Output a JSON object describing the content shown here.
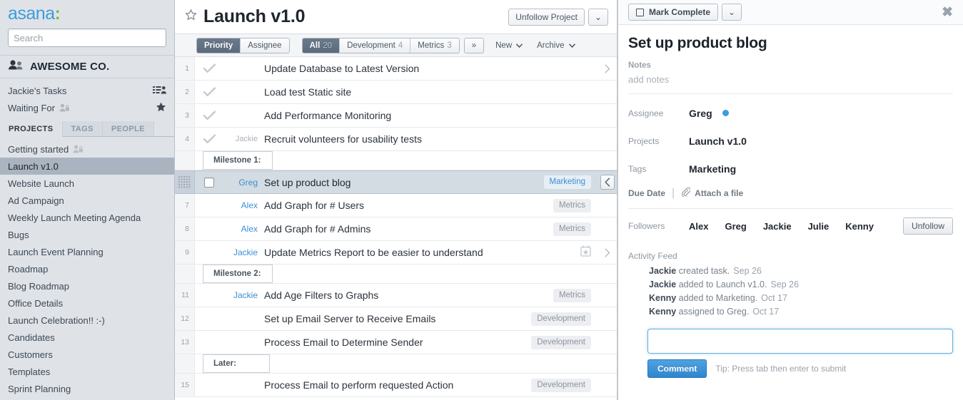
{
  "sidebar": {
    "logo": {
      "word": "asana",
      "colon": ":"
    },
    "search": {
      "placeholder": "Search",
      "value": ""
    },
    "org": {
      "name": "AWESOME CO.",
      "icon": "people-icon"
    },
    "nav": [
      {
        "label": "Jackie's Tasks",
        "right_icon": "list-people-icon"
      },
      {
        "label": "Waiting For",
        "lock": true,
        "right_icon": "star-icon"
      }
    ],
    "tabs": [
      {
        "label": "PROJECTS",
        "active": true
      },
      {
        "label": "TAGS",
        "active": false
      },
      {
        "label": "PEOPLE",
        "active": false
      }
    ],
    "projects": [
      {
        "label": "Getting started",
        "lock": true,
        "selected": false
      },
      {
        "label": "Launch v1.0",
        "lock": false,
        "selected": true
      },
      {
        "label": "Website Launch",
        "lock": false,
        "selected": false
      },
      {
        "label": "Ad Campaign",
        "lock": false,
        "selected": false
      },
      {
        "label": "Weekly Launch Meeting Agenda",
        "lock": false,
        "selected": false
      },
      {
        "label": "Bugs",
        "lock": false,
        "selected": false
      },
      {
        "label": "Launch Event Planning",
        "lock": false,
        "selected": false
      },
      {
        "label": "Roadmap",
        "lock": false,
        "selected": false
      },
      {
        "label": "Blog Roadmap",
        "lock": false,
        "selected": false
      },
      {
        "label": "Office Details",
        "lock": false,
        "selected": false
      },
      {
        "label": "Launch Celebration!! :-)",
        "lock": false,
        "selected": false
      },
      {
        "label": "Candidates",
        "lock": false,
        "selected": false
      },
      {
        "label": "Customers",
        "lock": false,
        "selected": false
      },
      {
        "label": "Templates",
        "lock": false,
        "selected": false
      },
      {
        "label": "Sprint Planning",
        "lock": false,
        "selected": false
      }
    ]
  },
  "main": {
    "header": {
      "title": "Launch  v1.0",
      "unfollow_label": "Unfollow Project",
      "caret": "⌄"
    },
    "sort_tabs": [
      {
        "label": "Priority",
        "active": true
      },
      {
        "label": "Assignee",
        "active": false
      }
    ],
    "filters": [
      {
        "label": "All",
        "count": "20",
        "active": true
      },
      {
        "label": "Development",
        "count": "4",
        "active": false
      },
      {
        "label": "Metrics",
        "count": "3",
        "active": false
      },
      {
        "label": "»",
        "count": "",
        "active": false
      }
    ],
    "menus": [
      {
        "label": "New"
      },
      {
        "label": "Archive"
      }
    ],
    "rows": [
      {
        "kind": "task",
        "num": "1",
        "state": "done",
        "assignee": "",
        "title": "Update Database to Latest Version",
        "tags": [],
        "chevron": true
      },
      {
        "kind": "task",
        "num": "2",
        "state": "done",
        "assignee": "",
        "title": "Load test Static site",
        "tags": [],
        "chevron": false
      },
      {
        "kind": "task",
        "num": "3",
        "state": "done",
        "assignee": "",
        "title": "Add Performance Monitoring",
        "tags": [],
        "chevron": false
      },
      {
        "kind": "task",
        "num": "4",
        "state": "done",
        "assignee": "Jackie",
        "title": "Recruit volunteers for usability tests",
        "tags": [],
        "chevron": false
      },
      {
        "kind": "milestone",
        "label": "Milestone 1:"
      },
      {
        "kind": "selected",
        "num": "",
        "state": "open",
        "assignee": "Greg",
        "title": "Set up product blog",
        "tags": [
          "Marketing"
        ],
        "collapse": "‹"
      },
      {
        "kind": "task",
        "num": "7",
        "state": "open",
        "assignee": "Alex",
        "title": "Add Graph for # Users",
        "tags": [
          "Metrics"
        ],
        "chevron": false
      },
      {
        "kind": "task",
        "num": "8",
        "state": "open",
        "assignee": "Alex",
        "title": "Add Graph for # Admins",
        "tags": [
          "Metrics"
        ],
        "chevron": false
      },
      {
        "kind": "task",
        "num": "9",
        "state": "open",
        "assignee": "Jackie",
        "title": "Update Metrics Report to be easier to understand",
        "tags": [],
        "calendar": true,
        "chevron": true
      },
      {
        "kind": "milestone",
        "label": "Milestone 2:"
      },
      {
        "kind": "task",
        "num": "11",
        "state": "open",
        "assignee": "Jackie",
        "title": "Add Age Filters to Graphs",
        "tags": [
          "Metrics"
        ],
        "chevron": false
      },
      {
        "kind": "task",
        "num": "12",
        "state": "open",
        "assignee": "",
        "title": "Set up Email Server to Receive Emails",
        "tags": [
          "Development"
        ],
        "chevron": false
      },
      {
        "kind": "task",
        "num": "13",
        "state": "open",
        "assignee": "",
        "title": "Process Email to Determine Sender",
        "tags": [
          "Development"
        ],
        "chevron": false
      },
      {
        "kind": "milestone",
        "label": "Later:"
      },
      {
        "kind": "task",
        "num": "15",
        "state": "open",
        "assignee": "",
        "title": "Process Email to perform requested Action",
        "tags": [
          "Development"
        ],
        "chevron": false
      }
    ]
  },
  "detail": {
    "mark_complete_label": "Mark Complete",
    "caret": "⌄",
    "close": "✖",
    "task_name": "Set up product blog",
    "notes_label": "Notes",
    "notes_placeholder": "add notes",
    "fields": [
      {
        "label": "Assignee",
        "value": "Greg",
        "dot": true
      },
      {
        "label": "Projects",
        "value": "Launch v1.0",
        "dot": false
      },
      {
        "label": "Tags",
        "value": "Marketing",
        "dot": false
      }
    ],
    "due_date_label": "Due Date",
    "attach_label": "Attach a file",
    "followers_label": "Followers",
    "followers": [
      "Alex",
      "Greg",
      "Jackie",
      "Julie",
      "Kenny"
    ],
    "unfollow_label": "Unfollow",
    "activity_label": "Activity Feed",
    "activity": [
      {
        "actor": "Jackie",
        "text": "created task.",
        "date": "Sep 26"
      },
      {
        "actor": "Jackie",
        "text": "added to Launch  v1.0.",
        "date": "Sep 26"
      },
      {
        "actor": "Kenny",
        "text": "added to Marketing.",
        "date": "Oct 17"
      },
      {
        "actor": "Kenny",
        "text": "assigned to Greg.",
        "date": "Oct 17"
      }
    ],
    "comment": {
      "value": "",
      "placeholder": "",
      "button_label": "Comment",
      "tip": "Tip: Press tab then enter to submit"
    }
  },
  "colors": {
    "accent_blue": "#3c9ddb",
    "logo_green": "#7dbb3e",
    "sidebar_bg": "#dfe3e8",
    "selected_row": "#d3dbe3",
    "active_seg": "#5b6a7c"
  }
}
